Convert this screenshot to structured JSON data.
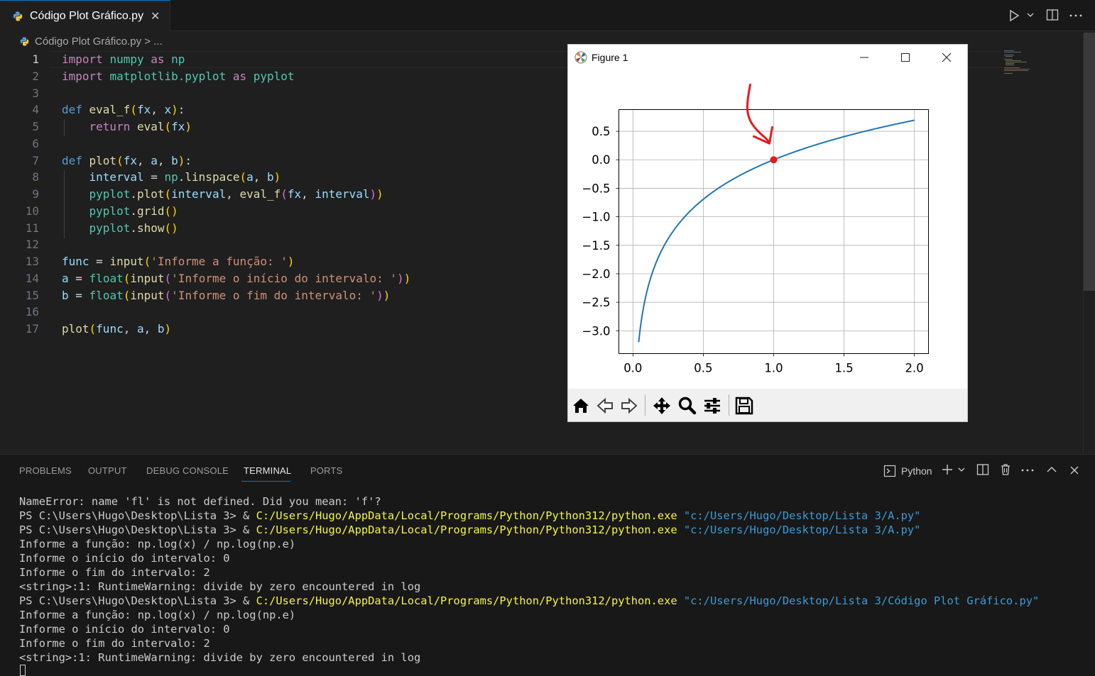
{
  "tab": {
    "label": "Código Plot Gráfico.py",
    "close": "✕"
  },
  "breadcrumb": {
    "text": "Código Plot Gráfico.py > ..."
  },
  "editor": {
    "active_line": 1,
    "lines": [
      {
        "n": "1",
        "tokens": [
          [
            "kw",
            "import "
          ],
          [
            "cls",
            "numpy"
          ],
          [
            "kw",
            " as "
          ],
          [
            "cls",
            "np"
          ]
        ]
      },
      {
        "n": "2",
        "tokens": [
          [
            "kw",
            "import "
          ],
          [
            "cls",
            "matplotlib.pyplot"
          ],
          [
            "kw",
            " as "
          ],
          [
            "cls",
            "pyplot"
          ]
        ]
      },
      {
        "n": "3",
        "tokens": []
      },
      {
        "n": "4",
        "tokens": [
          [
            "kwd",
            "def "
          ],
          [
            "fn",
            "eval_f"
          ],
          [
            "b1",
            "("
          ],
          [
            "vr",
            "fx"
          ],
          [
            "op",
            ", "
          ],
          [
            "vr",
            "x"
          ],
          [
            "b1",
            ")"
          ],
          [
            "op",
            ":"
          ]
        ]
      },
      {
        "n": "5",
        "tokens": [
          [
            "op",
            "    "
          ],
          [
            "kw",
            "return "
          ],
          [
            "fn",
            "eval"
          ],
          [
            "b1",
            "("
          ],
          [
            "vr",
            "fx"
          ],
          [
            "b1",
            ")"
          ]
        ]
      },
      {
        "n": "6",
        "tokens": []
      },
      {
        "n": "7",
        "tokens": [
          [
            "kwd",
            "def "
          ],
          [
            "fn",
            "plot"
          ],
          [
            "b1",
            "("
          ],
          [
            "vr",
            "fx"
          ],
          [
            "op",
            ", "
          ],
          [
            "vr",
            "a"
          ],
          [
            "op",
            ", "
          ],
          [
            "vr",
            "b"
          ],
          [
            "b1",
            ")"
          ],
          [
            "op",
            ":"
          ]
        ]
      },
      {
        "n": "8",
        "tokens": [
          [
            "op",
            "    "
          ],
          [
            "vr",
            "interval"
          ],
          [
            "op",
            " = "
          ],
          [
            "cls",
            "np"
          ],
          [
            "op",
            "."
          ],
          [
            "fn",
            "linspace"
          ],
          [
            "b1",
            "("
          ],
          [
            "vr",
            "a"
          ],
          [
            "op",
            ", "
          ],
          [
            "vr",
            "b"
          ],
          [
            "b1",
            ")"
          ]
        ]
      },
      {
        "n": "9",
        "tokens": [
          [
            "op",
            "    "
          ],
          [
            "cls",
            "pyplot"
          ],
          [
            "op",
            "."
          ],
          [
            "fn",
            "plot"
          ],
          [
            "b1",
            "("
          ],
          [
            "vr",
            "interval"
          ],
          [
            "op",
            ", "
          ],
          [
            "fn",
            "eval_f"
          ],
          [
            "b2",
            "("
          ],
          [
            "vr",
            "fx"
          ],
          [
            "op",
            ", "
          ],
          [
            "vr",
            "interval"
          ],
          [
            "b2",
            ")"
          ],
          [
            "b1",
            ")"
          ]
        ]
      },
      {
        "n": "10",
        "tokens": [
          [
            "op",
            "    "
          ],
          [
            "cls",
            "pyplot"
          ],
          [
            "op",
            "."
          ],
          [
            "fn",
            "grid"
          ],
          [
            "b1",
            "()"
          ]
        ]
      },
      {
        "n": "11",
        "tokens": [
          [
            "op",
            "    "
          ],
          [
            "cls",
            "pyplot"
          ],
          [
            "op",
            "."
          ],
          [
            "fn",
            "show"
          ],
          [
            "b1",
            "()"
          ]
        ]
      },
      {
        "n": "12",
        "tokens": []
      },
      {
        "n": "13",
        "tokens": [
          [
            "vr",
            "func"
          ],
          [
            "op",
            " = "
          ],
          [
            "fn",
            "input"
          ],
          [
            "b1",
            "("
          ],
          [
            "st",
            "'Informe a função: '"
          ],
          [
            "b1",
            ")"
          ]
        ]
      },
      {
        "n": "14",
        "tokens": [
          [
            "vr",
            "a"
          ],
          [
            "op",
            " = "
          ],
          [
            "cls",
            "float"
          ],
          [
            "b1",
            "("
          ],
          [
            "fn",
            "input"
          ],
          [
            "b2",
            "("
          ],
          [
            "st",
            "'Informe o início do intervalo: '"
          ],
          [
            "b2",
            ")"
          ],
          [
            "b1",
            ")"
          ]
        ]
      },
      {
        "n": "15",
        "tokens": [
          [
            "vr",
            "b"
          ],
          [
            "op",
            " = "
          ],
          [
            "cls",
            "float"
          ],
          [
            "b1",
            "("
          ],
          [
            "fn",
            "input"
          ],
          [
            "b2",
            "("
          ],
          [
            "st",
            "'Informe o fim do intervalo: '"
          ],
          [
            "b2",
            ")"
          ],
          [
            "b1",
            ")"
          ]
        ]
      },
      {
        "n": "16",
        "tokens": []
      },
      {
        "n": "17",
        "tokens": [
          [
            "fn",
            "plot"
          ],
          [
            "b1",
            "("
          ],
          [
            "vr",
            "func"
          ],
          [
            "op",
            ", "
          ],
          [
            "vr",
            "a"
          ],
          [
            "op",
            ", "
          ],
          [
            "vr",
            "b"
          ],
          [
            "b1",
            ")"
          ]
        ]
      }
    ]
  },
  "figure": {
    "title": "Figure 1",
    "chart_data": {
      "type": "line",
      "function": "ln(x)",
      "x_range": [
        0,
        2
      ],
      "x_first_plotted": 0.0408,
      "xlim": [
        -0.1,
        2.1
      ],
      "ylim": [
        -3.4,
        0.88
      ],
      "xticks": [
        0.0,
        0.5,
        1.0,
        1.5,
        2.0
      ],
      "xtick_labels": [
        "0.0",
        "0.5",
        "1.0",
        "1.5",
        "2.0"
      ],
      "yticks": [
        0.5,
        0.0,
        -0.5,
        -1.0,
        -1.5,
        -2.0,
        -2.5,
        -3.0
      ],
      "ytick_labels": [
        "0.5",
        "0.0",
        "−0.5",
        "−1.0",
        "−1.5",
        "−2.0",
        "−2.5",
        "−3.0"
      ],
      "grid": true,
      "line_color": "#1f77b4",
      "annotation": {
        "point": [
          1.0,
          0.0
        ],
        "color": "#e8191f",
        "kind": "hand-drawn arrow and dot"
      }
    },
    "toolbar": [
      "home-icon",
      "back-icon",
      "forward-icon",
      "pan-icon",
      "zoom-icon",
      "configure-icon",
      "save-icon"
    ]
  },
  "panel": {
    "tabs": [
      "PROBLEMS",
      "OUTPUT",
      "DEBUG CONSOLE",
      "TERMINAL",
      "PORTS"
    ],
    "active_tab": "TERMINAL",
    "shell": "Python",
    "terminal": [
      [
        [
          "",
          "NameError: name 'fl' is not defined. Did you mean: 'f'?"
        ]
      ],
      [
        [
          "",
          "PS C:\\Users\\Hugo\\Desktop\\Lista 3> & "
        ],
        [
          "t-yel",
          "C:/Users/Hugo/AppData/Local/Programs/Python/Python312/python.exe "
        ],
        [
          "t-cyan",
          "\"c:/Users/Hugo/Desktop/Lista 3/A.py\""
        ]
      ],
      [
        [
          "",
          "PS C:\\Users\\Hugo\\Desktop\\Lista 3> & "
        ],
        [
          "t-yel",
          "C:/Users/Hugo/AppData/Local/Programs/Python/Python312/python.exe "
        ],
        [
          "t-cyan",
          "\"c:/Users/Hugo/Desktop/Lista 3/A.py\""
        ]
      ],
      [
        [
          "",
          "Informe a função: np.log(x) / np.log(np.e)"
        ]
      ],
      [
        [
          "",
          "Informe o início do intervalo: 0"
        ]
      ],
      [
        [
          "",
          "Informe o fim do intervalo: 2"
        ]
      ],
      [
        [
          "",
          "<string>:1: RuntimeWarning: divide by zero encountered in log"
        ]
      ],
      [
        [
          "",
          "PS C:\\Users\\Hugo\\Desktop\\Lista 3> & "
        ],
        [
          "t-yel",
          "C:/Users/Hugo/AppData/Local/Programs/Python/Python312/python.exe "
        ],
        [
          "t-cyan",
          "\"c:/Users/Hugo/Desktop/Lista 3/Código Plot Gráfico.py\""
        ]
      ],
      [
        [
          "",
          "Informe a função: np.log(x) / np.log(np.e)"
        ]
      ],
      [
        [
          "",
          "Informe o início do intervalo: 0"
        ]
      ],
      [
        [
          "",
          "Informe o fim do intervalo: 2"
        ]
      ],
      [
        [
          "",
          "<string>:1: RuntimeWarning: divide by zero encountered in log"
        ]
      ]
    ]
  }
}
